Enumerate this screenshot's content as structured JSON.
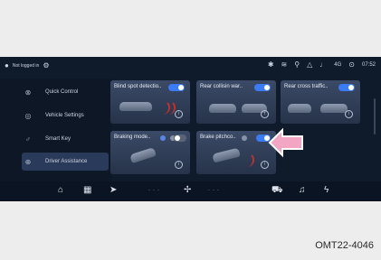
{
  "status": {
    "profile_label": "Not logged in",
    "icons": [
      "user-icon",
      "settings-icon",
      "bluetooth-icon",
      "wifi-off-icon",
      "signal-icon",
      "warning-icon",
      "mute-icon",
      "lte-icon",
      "gps-icon"
    ],
    "network": "4G",
    "time": "07:52"
  },
  "sidebar": {
    "items": [
      {
        "label": "Quick Control",
        "icon": "quick-control-icon"
      },
      {
        "label": "Vehicle Settings",
        "icon": "vehicle-settings-icon"
      },
      {
        "label": "Smart Key",
        "icon": "smart-key-icon"
      },
      {
        "label": "Driver Assistance",
        "icon": "driver-assistance-icon",
        "active": true
      }
    ]
  },
  "cards": [
    {
      "title": "Blind spot detectio..",
      "control": "toggle",
      "on": true
    },
    {
      "title": "Rear collisin war..",
      "control": "toggle",
      "on": true
    },
    {
      "title": "Rear cross traffic..",
      "control": "toggle",
      "on": true
    },
    {
      "title": "Braking mode..",
      "control": "segmented",
      "on": false
    },
    {
      "title": "Brake pitchco..",
      "control": "segmented",
      "on": true
    }
  ],
  "bottom": {
    "icons": [
      "home-icon",
      "apps-icon",
      "navigation-icon",
      "fan-icon",
      "car-icon",
      "music-icon",
      "phone-icon"
    ],
    "temp_left": "- - -",
    "temp_right": "- - -"
  },
  "caption": "OMT22-4046",
  "colors": {
    "accent": "#3b7bf5",
    "highlight_arrow": "#e25a8c"
  }
}
